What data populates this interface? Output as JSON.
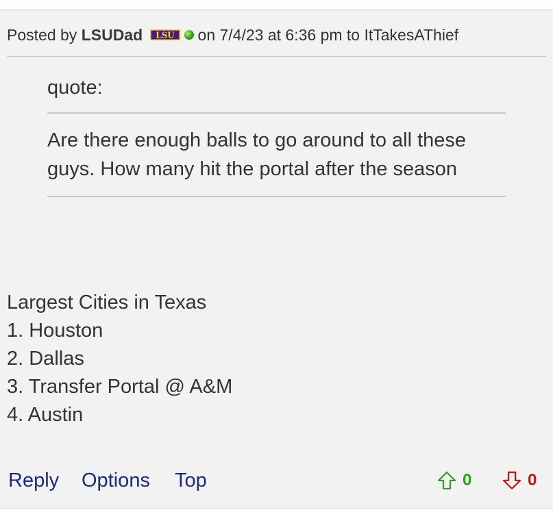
{
  "post": {
    "posted_by_prefix": "Posted by",
    "author": "LSUDad",
    "team_badge": "LSU",
    "status": "online",
    "meta_suffix": "on 7/4/23 at 6:36 pm to ItTakesAThief"
  },
  "quote": {
    "label": "quote:",
    "text": "Are there enough balls to go around to all these guys. How many hit the portal after the season"
  },
  "body_lines": [
    "Largest Cities in Texas",
    "1. Houston",
    "2. Dallas",
    "3. Transfer Portal @ A&M",
    "4. Austin"
  ],
  "footer": {
    "reply_label": "Reply",
    "options_label": "Options",
    "top_label": "Top",
    "upvotes": "0",
    "downvotes": "0"
  },
  "icons": {
    "upvote": "arrow-up-outline-icon",
    "downvote": "arrow-down-outline-icon",
    "status": "green-dot-icon"
  },
  "colors": {
    "link": "#1b2a7a",
    "upvote": "#2f9e1e",
    "downvote": "#c81414",
    "lsu_purple": "#461d7c",
    "lsu_gold": "#fdd023"
  }
}
